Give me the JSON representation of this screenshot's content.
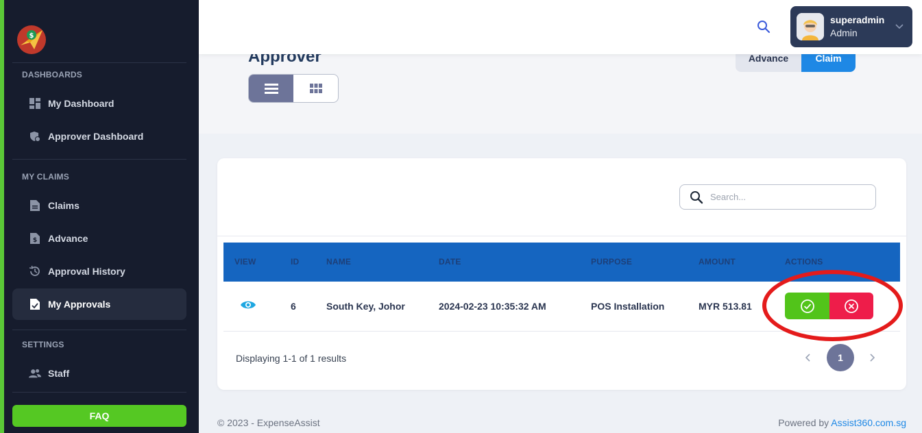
{
  "sidebar": {
    "sections": [
      {
        "title": "DASHBOARDS"
      },
      {
        "title": "MY CLAIMS"
      },
      {
        "title": "SETTINGS"
      }
    ],
    "items": [
      {
        "label": "My Dashboard",
        "icon": "dashboard-icon"
      },
      {
        "label": "Approver Dashboard",
        "icon": "shield-gear-icon"
      },
      {
        "label": "Claims",
        "icon": "document-icon"
      },
      {
        "label": "Advance",
        "icon": "dollar-document-icon"
      },
      {
        "label": "Approval History",
        "icon": "history-icon"
      },
      {
        "label": "My Approvals",
        "icon": "approval-document-icon",
        "active": true
      },
      {
        "label": "Staff",
        "icon": "users-icon"
      }
    ],
    "faq_label": "FAQ"
  },
  "topbar": {
    "user": {
      "name": "superadmin",
      "role": "Admin"
    }
  },
  "header": {
    "title": "Approver",
    "tabs": [
      "Advance",
      "Claim"
    ],
    "active_tab": "Claim"
  },
  "search": {
    "placeholder": "Search..."
  },
  "table": {
    "columns": [
      "VIEW",
      "ID",
      "NAME",
      "DATE",
      "PURPOSE",
      "AMOUNT",
      "ACTIONS"
    ],
    "rows": [
      {
        "id": "6",
        "name": "South Key, Johor",
        "date": "2024-02-23 10:35:32 AM",
        "purpose": "POS Installation",
        "amount": "MYR 513.81"
      }
    ]
  },
  "pagination": {
    "results_text": "Displaying 1-1 of 1 results",
    "current_page": "1"
  },
  "footer": {
    "copyright": "© 2023 - ExpenseAssist",
    "powered_prefix": "Powered by",
    "powered_link": "Assist360.com.sg"
  },
  "colors": {
    "primary": "#1e88e5",
    "sidebar_bg": "#161c2d",
    "approve": "#52c41a",
    "reject": "#ee1d4a",
    "faq": "#55c823",
    "highlight_ring": "#e41b1b"
  }
}
